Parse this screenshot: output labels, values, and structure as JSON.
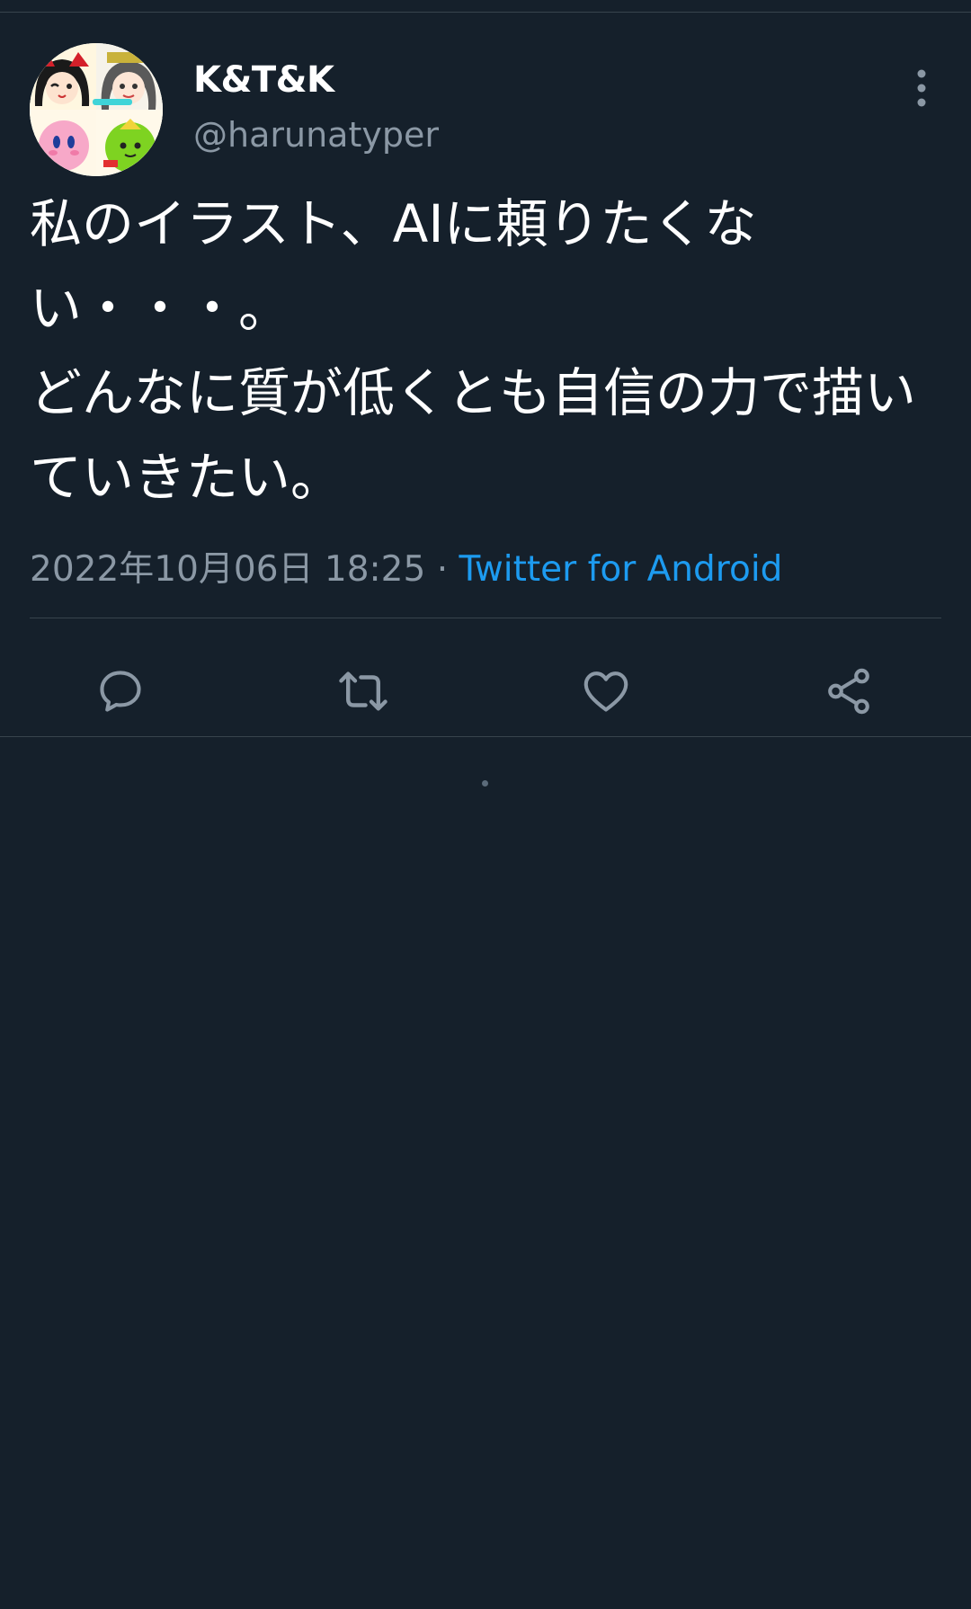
{
  "tweet": {
    "display_name": "K&T&K",
    "handle": "@harunatyper",
    "text": "私のイラスト、AIに頼りたくない・・・。\nどんなに質が低くとも自信の力で描いていきたい。",
    "timestamp": "2022年10月06日 18:25",
    "separator": " · ",
    "source": "Twitter for Android"
  },
  "icons": {
    "more": "more-vertical-icon",
    "reply": "reply-icon",
    "retweet": "retweet-icon",
    "like": "heart-icon",
    "share": "share-icon"
  },
  "colors": {
    "background": "#15202b",
    "text_primary": "#ffffff",
    "text_secondary": "#8b98a5",
    "accent": "#1d9bf0",
    "divider": "#38444d"
  }
}
